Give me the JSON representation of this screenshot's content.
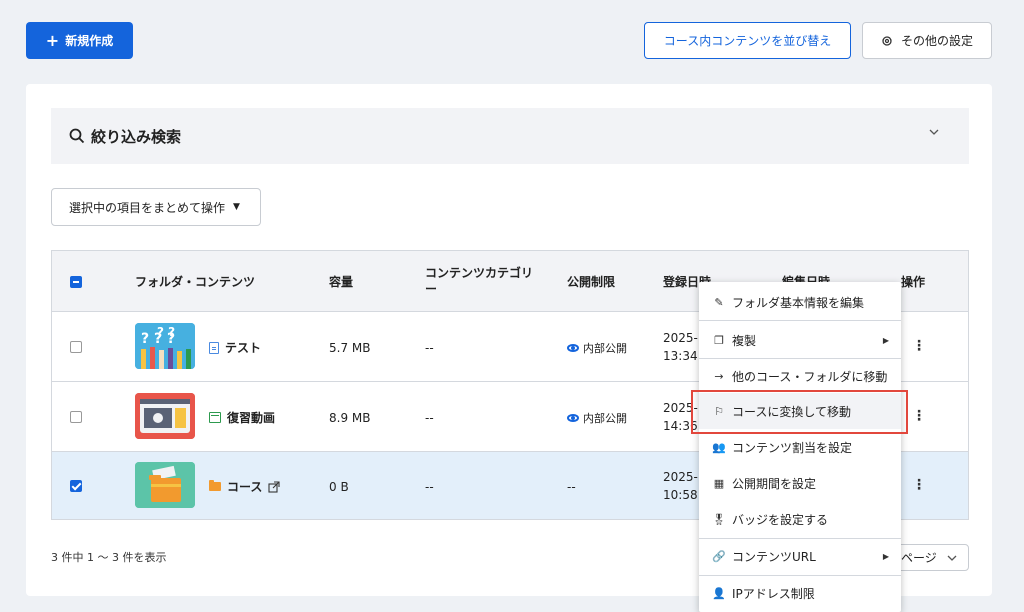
{
  "toolbar": {
    "new_label": "新規作成",
    "reorder_label": "コース内コンテンツを並び替え",
    "settings_label": "その他の設定"
  },
  "filter": {
    "label": "絞り込み検索"
  },
  "bulk_action": {
    "label": "選択中の項目をまとめて操作"
  },
  "table": {
    "headers": {
      "folder": "フォルダ・コンテンツ",
      "size": "容量",
      "category_line1": "コンテンツカテゴリ",
      "category_line2": "ー",
      "visibility": "公開制限",
      "registered": "登録日時",
      "edited": "編集日時",
      "actions": "操作"
    },
    "rows": [
      {
        "name": "テスト",
        "size": "5.7 MB",
        "category": "--",
        "visibility": "内部公開",
        "date_line1": "2025-",
        "date_line2": "13:34",
        "checked": false
      },
      {
        "name": "復習動画",
        "size": "8.9 MB",
        "category": "--",
        "visibility": "内部公開",
        "date_line1": "2025-",
        "date_line2": "14:36",
        "checked": false
      },
      {
        "name": "コース",
        "size": "0 B",
        "category": "--",
        "visibility": "--",
        "date_line1": "2025-",
        "date_line2": "10:58",
        "checked": true
      }
    ]
  },
  "footer": {
    "count_text": "3 件中 1 ～ 3 件を表示",
    "pager_label": "ページ"
  },
  "context_menu": {
    "items": [
      {
        "label": "フォルダ基本情報を編集",
        "icon": "pencil-icon"
      },
      {
        "label": "複製",
        "icon": "copy-icon",
        "submenu": true
      },
      {
        "label": "他のコース・フォルダに移動",
        "icon": "arrow-right-icon"
      },
      {
        "label": "コースに変換して移動",
        "icon": "flag-icon",
        "highlighted": true
      },
      {
        "label": "コンテンツ割当を設定",
        "icon": "users-icon"
      },
      {
        "label": "公開期間を設定",
        "icon": "calendar-icon"
      },
      {
        "label": "バッジを設定する",
        "icon": "badge-icon"
      },
      {
        "label": "コンテンツURL",
        "icon": "link-icon",
        "submenu": true
      },
      {
        "label": "IPアドレス制限",
        "icon": "user-lock-icon"
      }
    ]
  },
  "colors": {
    "primary": "#1464dc",
    "highlight": "#e2473c",
    "selected_row": "#e3effa"
  }
}
